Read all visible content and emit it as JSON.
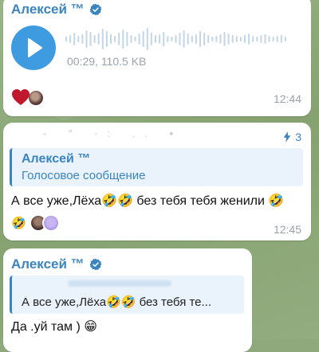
{
  "message1": {
    "sender": "Алексей ™",
    "voice": {
      "meta": "00:29, 110.5 KB"
    },
    "reactions": [
      "heart",
      "avatar"
    ],
    "time": "12:44"
  },
  "message2": {
    "top_blur_text": "- \" ·: .. •",
    "reply_count": "3",
    "quote": {
      "sender": "Алексей ™",
      "text": "Голосовое сообщение"
    },
    "text": "А все уже,Лёха🤣🤣 без тебя тебя женили 🤣",
    "reactions": [
      "🤣",
      "avatar",
      "avatar-purple"
    ],
    "time": "12:45"
  },
  "message3": {
    "sender": "Алексей ™",
    "quote": {
      "text": "А все уже,Лёха🤣🤣 без тебя те..."
    },
    "text": "Да .уй там ) 😁"
  },
  "colors": {
    "accent": "#3a84c0",
    "play_button": "#3e9be0",
    "time": "#9aa3ab",
    "quote_bg": "#eaf3fb"
  }
}
